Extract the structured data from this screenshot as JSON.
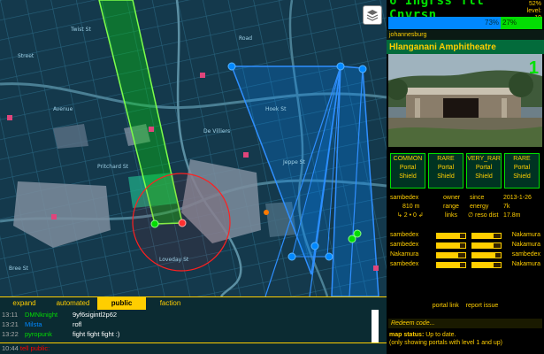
{
  "player": {
    "name": "6 Ingrss Ttl Cnvrsn",
    "xm": "XM: 52%",
    "level": "level: 10"
  },
  "score": {
    "res": "73%",
    "enl": "27%",
    "res_fraction": 0.73,
    "enl_fraction": 0.27
  },
  "portal": {
    "city": "johannesburg",
    "title": "Hlanganani Amphitheatre",
    "level": "1",
    "mods": [
      {
        "rarity": "COMMON",
        "l1": "Portal",
        "l2": "Shield"
      },
      {
        "rarity": "RARE",
        "l1": "Portal",
        "l2": "Shield"
      },
      {
        "rarity": "VERY_RAR",
        "l1": "Portal",
        "l2": "Shield"
      },
      {
        "rarity": "RARE",
        "l1": "Portal",
        "l2": "Shield"
      }
    ],
    "info": {
      "owner_name": "sambedex",
      "owner_label": "owner",
      "since_label": "since",
      "since_value": "2013-1-26",
      "range_value": "810 m",
      "range_label": "range",
      "energy_label": "energy",
      "energy_value": "7k",
      "links_value": "↳ 2 • 0 ↲",
      "links_label": "links",
      "reso_dist_label": "∅ reso dist",
      "reso_dist_value": "17.8m"
    },
    "resonators": [
      {
        "left": "sambedex",
        "left_fill": 0.8,
        "right": "Nakamura",
        "right_fill": 0.75
      },
      {
        "left": "sambedex",
        "left_fill": 0.8,
        "right": "Nakamura",
        "right_fill": 0.75
      },
      {
        "left": "Nakamura",
        "left_fill": 0.75,
        "right": "sambedex",
        "right_fill": 0.8
      },
      {
        "left": "sambedex",
        "left_fill": 0.8,
        "right": "Nakamura",
        "right_fill": 0.75
      }
    ],
    "links": {
      "portal_link": "portal link",
      "report_issue": "report issue"
    }
  },
  "redeem": {
    "placeholder": "Redeem code..."
  },
  "map_status": {
    "label": "map status:",
    "value": "Up to date.",
    "note": "(only showing portals with level 1 and up)"
  },
  "chat": {
    "tabs": [
      "expand",
      "automated",
      "public",
      "faction"
    ],
    "active_tab": "public",
    "lines": [
      {
        "time": "13:11",
        "user": "DMNknight",
        "user_color": "#03dc03",
        "msg": "9yf6sigintl2p62"
      },
      {
        "time": "13:21",
        "user": "Milsta",
        "user_color": "#0088ff",
        "msg": "rofl"
      },
      {
        "time": "13:22",
        "user": "pyropunk",
        "user_color": "#03dc03",
        "msg": "fight fight fight :)"
      }
    ],
    "input_time": "10:44",
    "input_label": "tell public:"
  },
  "map": {
    "labels": [
      "Street",
      "Road",
      "Avenue",
      "De Villiers",
      "Pritchard St",
      "Jeppe St",
      "Loveday St",
      "Bree St",
      "Hoek St",
      "Twist St"
    ],
    "colors": {
      "res": "#0088ff",
      "enl": "#03dc03",
      "neutral": "#ff0000"
    }
  }
}
